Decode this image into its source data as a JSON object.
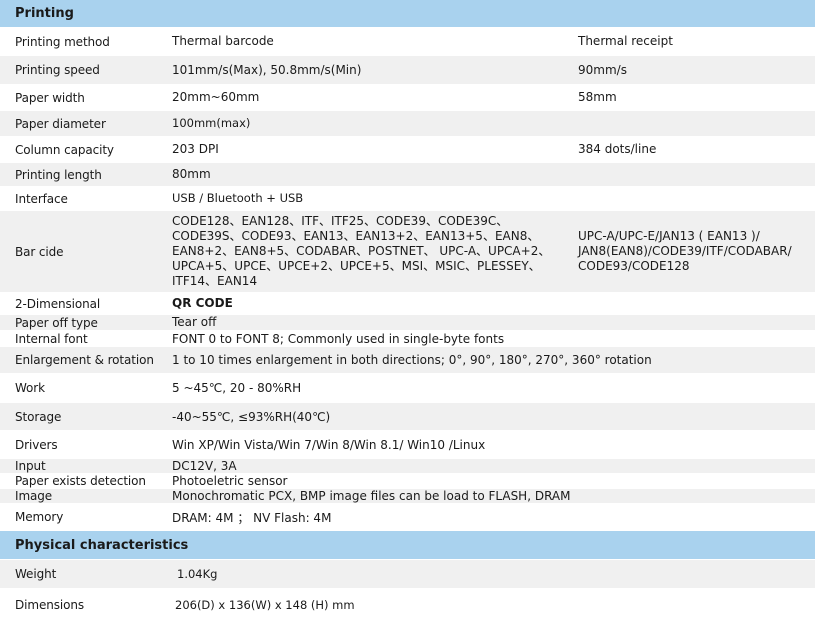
{
  "printing": {
    "title": "Printing",
    "method": {
      "label": "Printing method",
      "barcode": "Thermal barcode",
      "receipt": "Thermal receipt"
    },
    "speed": {
      "label": "Printing speed",
      "barcode": "101mm/s(Max), 50.8mm/s(Min)",
      "receipt": "90mm/s"
    },
    "paper_width": {
      "label": "Paper width",
      "barcode": "20mm~60mm",
      "receipt": "58mm"
    },
    "paper_diameter": {
      "label": "Paper diameter",
      "value": "100mm(max)"
    },
    "column_capacity": {
      "label": "Column capacity",
      "barcode": "203 DPI",
      "receipt": "384 dots/line"
    },
    "length": {
      "label": "Printing length",
      "value": "80mm"
    },
    "interface": {
      "label": "Interface",
      "value": "USB / Bluetooth + USB"
    },
    "barcode": {
      "label": "Bar cide",
      "barcode": "CODE128、EAN128、ITF、ITF25、CODE39、CODE39C、\nCODE39S、CODE93、EAN13、EAN13+2、EAN13+5、EAN8、\nEAN8+2、EAN8+5、CODABAR、POSTNET、 UPC-A、UPCA+2、\nUPCA+5、UPCE、UPCE+2、UPCE+5、MSI、MSIC、PLESSEY、\nITF14、EAN14",
      "receipt": "UPC-A/UPC-E/JAN13 ( EAN13 )/\nJAN8(EAN8)/CODE39/ITF/CODABAR/\nCODE93/CODE128"
    },
    "two_d": {
      "label": "2-Dimensional",
      "value": "QR CODE"
    },
    "paper_off": {
      "label": "Paper off type",
      "value": "Tear off"
    },
    "internal_font": {
      "label": "Internal font",
      "value": "FONT 0 to FONT 8; Commonly used in single-byte fonts"
    },
    "enlargement": {
      "label": "Enlargement & rotation",
      "value": "1 to 10 times enlargement in both directions; 0°, 90°, 180°, 270°, 360° rotation"
    },
    "work": {
      "label": "Work",
      "value": "5 ~45℃, 20 - 80%RH"
    },
    "storage": {
      "label": "Storage",
      "value": "-40~55℃, ≤93%RH(40℃)"
    },
    "drivers": {
      "label": "Drivers",
      "value": "Win XP/Win Vista/Win 7/Win 8/Win 8.1/ Win10 /Linux"
    },
    "input": {
      "label": "Input",
      "value": "DC12V, 3A"
    },
    "paper_detect": {
      "label": "Paper exists detection",
      "value": "Photoeletric sensor"
    },
    "image": {
      "label": "Image",
      "value": "Monochromatic PCX, BMP image files can be load to FLASH, DRAM"
    },
    "memory": {
      "label": "Memory",
      "value": "DRAM: 4M ； NV Flash: 4M"
    }
  },
  "physical": {
    "title": "Physical characteristics",
    "weight": {
      "label": "Weight",
      "value": "1.04Kg"
    },
    "dimensions": {
      "label": "Dimensions",
      "value": "206(D) x 136(W)  x 148 (H) mm"
    }
  }
}
